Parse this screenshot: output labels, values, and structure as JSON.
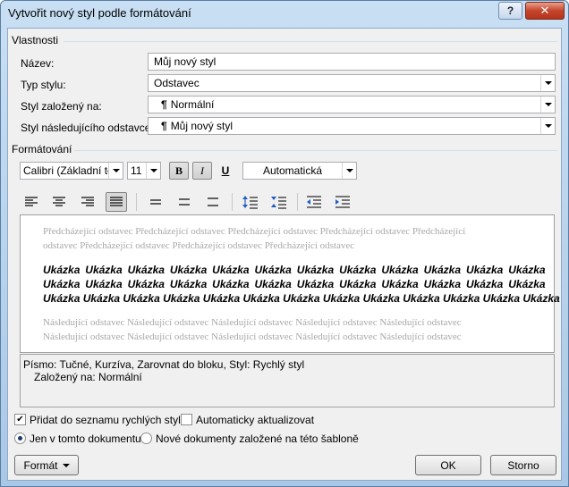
{
  "window": {
    "title": "Vytvořit nový styl podle formátování",
    "help_glyph": "?",
    "close_glyph": "✕"
  },
  "properties": {
    "heading": "Vlastnosti",
    "name_label": "Název:",
    "name_value": "Můj nový styl",
    "type_label": "Typ stylu:",
    "type_value": "Odstavec",
    "based_label": "Styl založený na:",
    "based_value": "Normální",
    "next_label": "Styl následujícího odstavce:",
    "next_value": "Můj nový styl"
  },
  "formatting": {
    "heading": "Formátování",
    "font": "Calibri (Základní tex",
    "size": "11",
    "bold": "B",
    "italic": "I",
    "underline": "U",
    "color": "Automatická"
  },
  "preview": {
    "previous_line1": "Předcházející odstavec Předcházející odstavec Předcházející odstavec Předcházející odstavec Předcházející",
    "previous_line2": "odstavec Předcházející odstavec Předcházející odstavec Předcházející odstavec",
    "sample_line1": "Ukázka Ukázka Ukázka Ukázka Ukázka Ukázka Ukázka Ukázka Ukázka Ukázka Ukázka Ukázka",
    "sample_line2": "Ukázka Ukázka Ukázka Ukázka Ukázka Ukázka Ukázka Ukázka Ukázka Ukázka Ukázka Ukázka",
    "sample_line3": "Ukázka Ukázka Ukázka Ukázka Ukázka Ukázka Ukázka Ukázka Ukázka Ukázka Ukázka Ukázka Ukázka",
    "following_line1": "Následující odstavec Následující odstavec Následující odstavec Následující odstavec Následující odstavec",
    "following_line2": "Následující odstavec Následující odstavec Následující odstavec Následující odstavec Následující odstavec"
  },
  "description": {
    "line1": "Písmo: Tučné, Kurzíva, Zarovnat do bloku, Styl: Rychlý styl",
    "line2": "Založený na: Normální"
  },
  "options": {
    "add_quick": "Přidat do seznamu rychlých stylů",
    "add_quick_checked": true,
    "auto_update": "Automaticky aktualizovat",
    "auto_update_checked": false,
    "only_doc": "Jen v tomto dokumentu",
    "new_docs": "Nové dokumenty založené na této šabloně",
    "selected_scope": "only_doc"
  },
  "buttons": {
    "format": "Formát",
    "ok": "OK",
    "cancel": "Storno"
  }
}
